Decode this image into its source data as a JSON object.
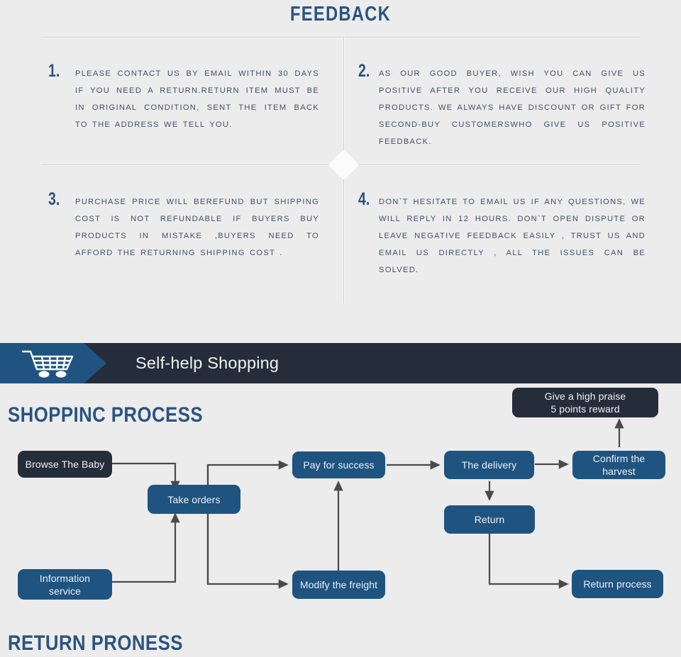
{
  "feedback": {
    "title": "FEEDBACK",
    "items": [
      {
        "number": "1.",
        "text": "PLEASE CONTACT US BY EMAIL WITHIN 30 DAYS IF YOU NEED A RETURN.RETURN ITEM MUST BE IN ORIGINAL CONDITION, SENT THE ITEM BACK TO THE ADDRESS WE TELL YOU."
      },
      {
        "number": "2.",
        "text": "AS OUR GOOD BUYER, WISH YOU CAN GIVE US POSITIVE AFTER YOU RECEIVE OUR HIGH QUALITY PRODUCTS. WE ALWAYS HAVE DISCOUNT OR GIFT FOR SECOND-BUY CUSTOMERSWHO GIVE US POSITIVE FEEDBACK."
      },
      {
        "number": "3.",
        "text": "PURCHASE PRICE WILL BEREFUND BUT SHIPPING COST IS NOT REFUNDABLE IF BUYERS BUY PRODUCTS IN MISTAKE ,BUYERS NEED TO AFFORD THE RETURNING SHIPPING COST ."
      },
      {
        "number": "4.",
        "text": "DON`T HESITATE TO EMAIL US IF ANY QUESTIONS, WE WILL REPLY IN 12 HOURS. DON`T OPEN DISPUTE OR LEAVE NEGATIVE FEEDBACK EASILY , TRUST US AND EMAIL US DIRECTLY , ALL THE ISSUES CAN BE SOLVED."
      }
    ]
  },
  "banner": {
    "title": "Self-help Shopping",
    "icon": "shopping-cart-icon"
  },
  "headings": {
    "shopping_process": "SHOPPINC PROCESS",
    "return_process": "RETURN  PRONESS"
  },
  "flowchart": {
    "nodes": [
      {
        "id": "browse-the-baby",
        "label": "Browse The Baby",
        "style": "dark"
      },
      {
        "id": "take-orders",
        "label": "Take orders",
        "style": "blue"
      },
      {
        "id": "information-service",
        "label": "Information\nservice",
        "style": "blue"
      },
      {
        "id": "pay-for-success",
        "label": "Pay for success",
        "style": "blue"
      },
      {
        "id": "modify-the-freight",
        "label": "Modify the freight",
        "style": "blue"
      },
      {
        "id": "the-delivery",
        "label": "The delivery",
        "style": "blue"
      },
      {
        "id": "return",
        "label": "Return",
        "style": "blue"
      },
      {
        "id": "confirm-the-harvest",
        "label": "Confirm the\nharvest",
        "style": "blue"
      },
      {
        "id": "give-a-high-praise",
        "label": "Give a high praise\n5 points reward",
        "style": "dark"
      },
      {
        "id": "return-process",
        "label": "Return process",
        "style": "blue"
      }
    ],
    "edges": [
      {
        "from": "browse-the-baby",
        "to": "take-orders"
      },
      {
        "from": "information-service",
        "to": "take-orders"
      },
      {
        "from": "take-orders",
        "to": "pay-for-success"
      },
      {
        "from": "take-orders",
        "to": "modify-the-freight"
      },
      {
        "from": "modify-the-freight",
        "to": "pay-for-success"
      },
      {
        "from": "pay-for-success",
        "to": "the-delivery"
      },
      {
        "from": "the-delivery",
        "to": "confirm-the-harvest"
      },
      {
        "from": "the-delivery",
        "to": "return"
      },
      {
        "from": "confirm-the-harvest",
        "to": "give-a-high-praise"
      },
      {
        "from": "return",
        "to": "return-process"
      }
    ]
  },
  "colors": {
    "background": "#ececed",
    "accent_blue": "#1f5380",
    "dark_navy": "#252d3a",
    "heading_blue": "#2b5380",
    "body_text": "#3f506b"
  }
}
